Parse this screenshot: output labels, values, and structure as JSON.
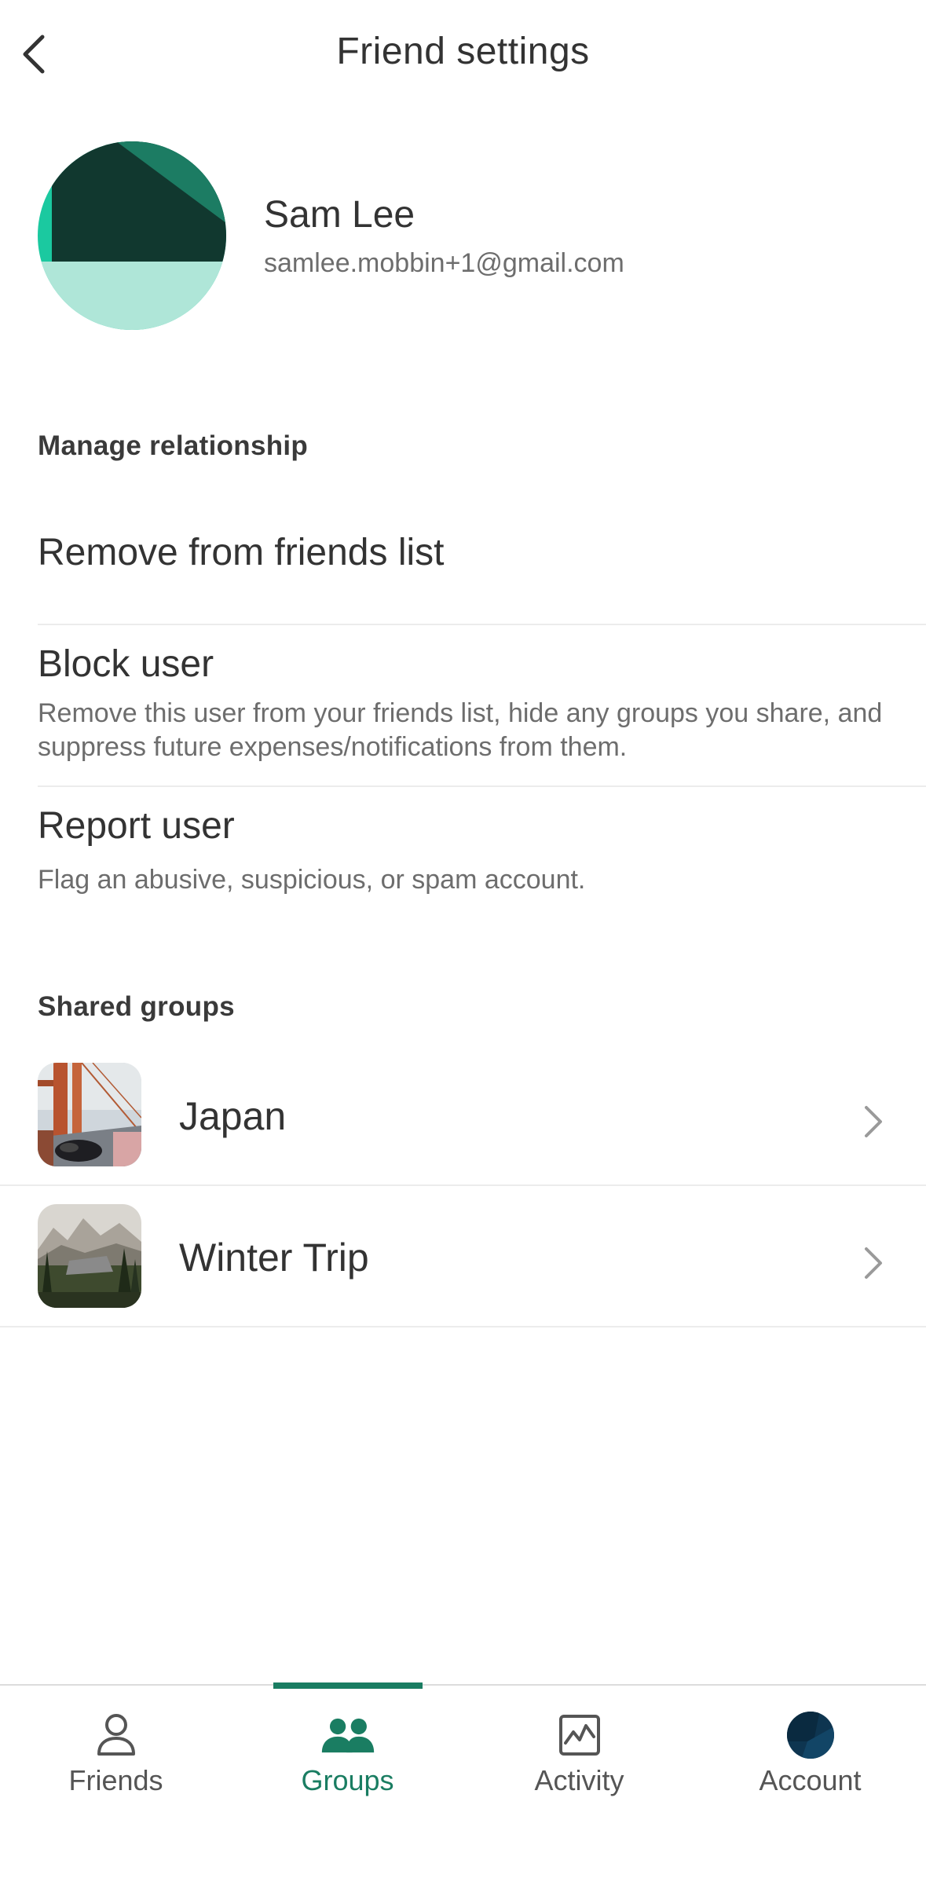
{
  "header": {
    "title": "Friend settings",
    "back_icon": "chevron-left-icon"
  },
  "profile": {
    "name": "Sam Lee",
    "email": "samlee.mobbin+1@gmail.com",
    "avatar_colors": [
      "#1bc9a0",
      "#11382f",
      "#1c7c63",
      "#afe6d8"
    ]
  },
  "manage": {
    "section_title": "Manage relationship",
    "remove_label": "Remove from friends list",
    "block_label": "Block user",
    "block_desc": "Remove this user from your friends list, hide any groups you share, and suppress future expenses/notifications from them.",
    "report_label": "Report user",
    "report_desc": "Flag an abusive, suspicious, or spam account."
  },
  "shared_groups": {
    "section_title": "Shared groups",
    "items": [
      {
        "name": "Japan",
        "icon": "bridge-photo"
      },
      {
        "name": "Winter Trip",
        "icon": "mountain-photo"
      }
    ]
  },
  "tabbar": {
    "active": "Groups",
    "accent_color": "#1a7d62",
    "tabs": [
      {
        "label": "Friends",
        "icon": "person-icon"
      },
      {
        "label": "Groups",
        "icon": "group-icon"
      },
      {
        "label": "Activity",
        "icon": "activity-icon"
      },
      {
        "label": "Account",
        "icon": "account-avatar-icon"
      }
    ]
  }
}
